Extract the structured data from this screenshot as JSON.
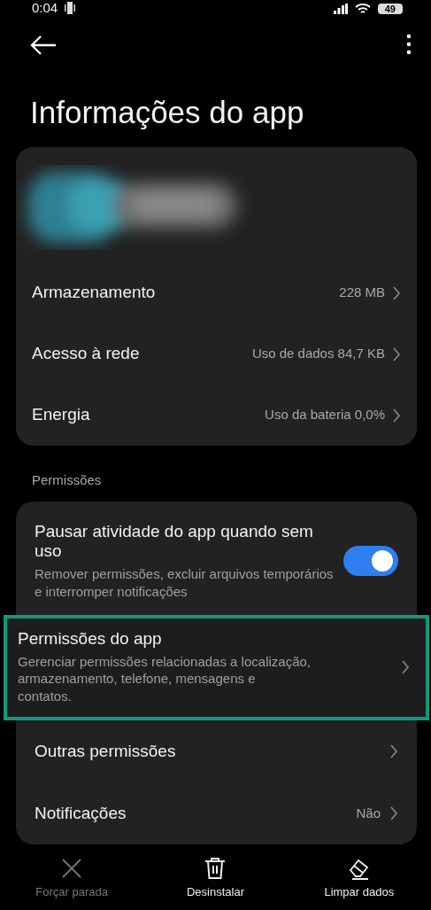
{
  "status_bar": {
    "time": "0:04",
    "battery": "49"
  },
  "title": "Informações do app",
  "info_rows": [
    {
      "label": "Armazenamento",
      "value": "228 MB"
    },
    {
      "label": "Acesso à rede",
      "value": "Uso de dados 84,7 KB"
    },
    {
      "label": "Energia",
      "value": "Uso da bateria 0,0%"
    }
  ],
  "section_title": "Permissões",
  "permission_rows": [
    {
      "kind": "toggle",
      "label": "Pausar atividade do app quando sem uso",
      "description": "Remover permissões, excluir arquivos temporários e interromper notificações",
      "on": true,
      "highlighted": false
    },
    {
      "kind": "link",
      "label": "Permissões do app",
      "description": "Gerenciar permissões relacionadas a localização, armazenamento, telefone, mensagens e contatos.",
      "highlighted": true
    },
    {
      "kind": "link",
      "label": "Outras permissões",
      "highlighted": false
    },
    {
      "kind": "link",
      "label": "Notificações",
      "value": "Não",
      "highlighted": false
    }
  ],
  "bottom_actions": [
    {
      "label": "Forçar parada",
      "kind": "close",
      "disabled": true
    },
    {
      "label": "Desinstalar",
      "kind": "trash",
      "disabled": false
    },
    {
      "label": "Limpar dados",
      "kind": "eraser",
      "disabled": false
    }
  ]
}
